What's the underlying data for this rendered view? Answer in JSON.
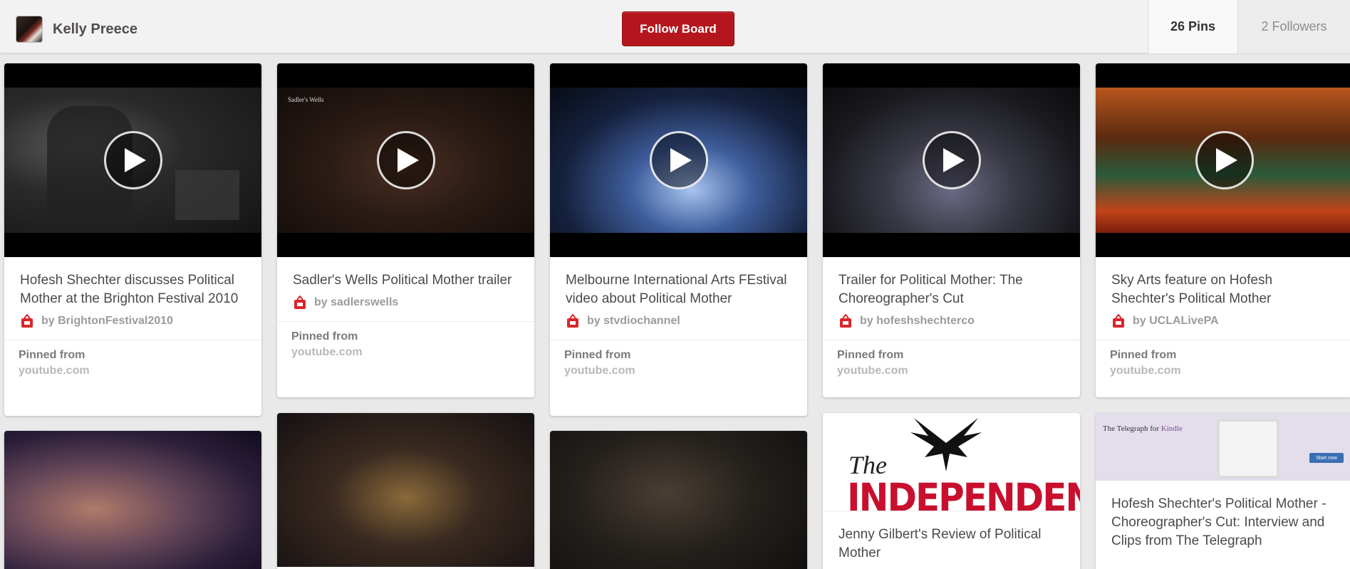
{
  "header": {
    "owner_name": "Kelly Preece",
    "follow_button": "Follow Board",
    "pins_count": "26 Pins",
    "followers_count": "2 Followers"
  },
  "pins": [
    {
      "description": "Hofesh Shechter discusses Political Mother at the Brighton Festival 2010",
      "byline": "by BrightonFestival2010",
      "pinned_label": "Pinned from",
      "pinned_domain": "youtube.com"
    },
    {
      "description": "Sadler's Wells Political Mother trailer",
      "byline": "by sadlerswells",
      "pinned_label": "Pinned from",
      "pinned_domain": "youtube.com",
      "video_caption": "Sadler's Wells"
    },
    {
      "description": "Melbourne International Arts FEstival video about Political Mother",
      "byline": "by stvdiochannel",
      "pinned_label": "Pinned from",
      "pinned_domain": "youtube.com"
    },
    {
      "description": "Trailer for Political Mother: The Choreographer's Cut",
      "byline": "by hofeshshechterco",
      "pinned_label": "Pinned from",
      "pinned_domain": "youtube.com"
    },
    {
      "description": "Sky Arts feature on Hofesh Shechter's Political Mother",
      "byline": "by UCLALivePA",
      "pinned_label": "Pinned from",
      "pinned_domain": "youtube.com"
    }
  ],
  "row2": {
    "independent": {
      "logo_the": "The",
      "logo_word": "INDEPENDENT",
      "description": "Jenny Gilbert's Review of Political Mother"
    },
    "telegraph": {
      "logo_text": "The Telegraph for",
      "logo_kindle": "Kindle",
      "button_text": "Start now",
      "description": "Hofesh Shechter's Political Mother - Choreographer's Cut: Interview and Clips from The Telegraph"
    }
  },
  "colors": {
    "follow_button": "#b5161d",
    "independent_red": "#c8102e",
    "youtube_red": "#d9262b"
  }
}
